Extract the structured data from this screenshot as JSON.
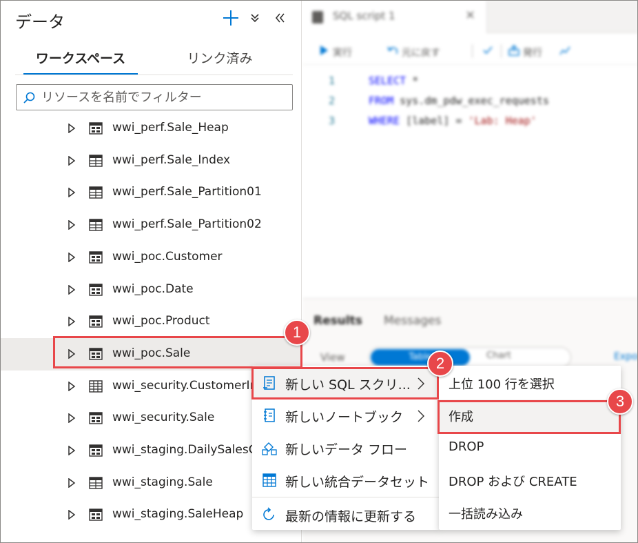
{
  "panel": {
    "title": "データ",
    "tabs": [
      {
        "label": "ワークスペース",
        "active": true
      },
      {
        "label": "リンク済み",
        "active": false
      }
    ],
    "filter_placeholder": "リソースを名前でフィルター",
    "tree_items": [
      {
        "label": "wwi_perf.Sale_Heap",
        "icon": "table-heap-icon"
      },
      {
        "label": "wwi_perf.Sale_Index",
        "icon": "table-icon"
      },
      {
        "label": "wwi_perf.Sale_Partition01",
        "icon": "table-icon"
      },
      {
        "label": "wwi_perf.Sale_Partition02",
        "icon": "table-icon"
      },
      {
        "label": "wwi_poc.Customer",
        "icon": "table-heap-icon"
      },
      {
        "label": "wwi_poc.Date",
        "icon": "table-heap-icon"
      },
      {
        "label": "wwi_poc.Product",
        "icon": "table-heap-icon"
      },
      {
        "label": "wwi_poc.Sale",
        "icon": "table-heap-icon",
        "selected": true
      },
      {
        "label": "wwi_security.CustomerInfo",
        "icon": "table-grid-icon"
      },
      {
        "label": "wwi_security.Sale",
        "icon": "table-heap-icon"
      },
      {
        "label": "wwi_staging.DailySalesCounts",
        "icon": "table-heap-icon"
      },
      {
        "label": "wwi_staging.Sale",
        "icon": "table-icon"
      },
      {
        "label": "wwi_staging.SaleHeap",
        "icon": "table-heap-icon"
      }
    ]
  },
  "editor": {
    "tab_label": "SQL script 1",
    "toolbar": {
      "run": "実行",
      "undo": "元に戻す",
      "publish": "発行"
    },
    "code": [
      {
        "num": "1",
        "parts": [
          {
            "t": "SELECT",
            "c": "kw"
          },
          {
            "t": " *",
            "c": "tx"
          }
        ]
      },
      {
        "num": "2",
        "parts": [
          {
            "t": "    FROM",
            "c": "kw"
          },
          {
            "t": "   sys.dm_pdw_exec_requests",
            "c": "tx"
          }
        ]
      },
      {
        "num": "3",
        "parts": [
          {
            "t": "    WHERE",
            "c": "kw"
          },
          {
            "t": "  [label] = ",
            "c": "tx"
          },
          {
            "t": "'Lab: Heap'",
            "c": "str"
          }
        ]
      }
    ],
    "results": {
      "tab_results": "Results",
      "tab_messages": "Messages",
      "view_label": "View",
      "view_table": "Table",
      "view_chart": "Chart",
      "export": "Export"
    }
  },
  "context_menu": {
    "items": [
      {
        "label": "新しい SQL スクリ...",
        "icon": "sql-script-icon",
        "submenu": true,
        "hover": true
      },
      {
        "label": "新しいノートブック",
        "icon": "notebook-icon",
        "submenu": true
      },
      {
        "label": "新しいデータ フロー",
        "icon": "dataflow-icon",
        "submenu": false
      },
      {
        "label": "新しい統合データセット",
        "icon": "dataset-icon",
        "submenu": false
      },
      {
        "label": "最新の情報に更新する",
        "icon": "refresh-icon",
        "submenu": false
      }
    ]
  },
  "submenu": {
    "items": [
      {
        "label": "上位 100 行を選択"
      },
      {
        "label": "作成",
        "hover": true
      },
      {
        "label": "DROP"
      },
      {
        "label": "DROP および CREATE"
      },
      {
        "label": "一括読み込み"
      }
    ]
  },
  "callouts": [
    "1",
    "2",
    "3"
  ],
  "colors": {
    "accent": "#0078d4",
    "callout": "#e8474a",
    "selected_row": "#edebe9"
  }
}
